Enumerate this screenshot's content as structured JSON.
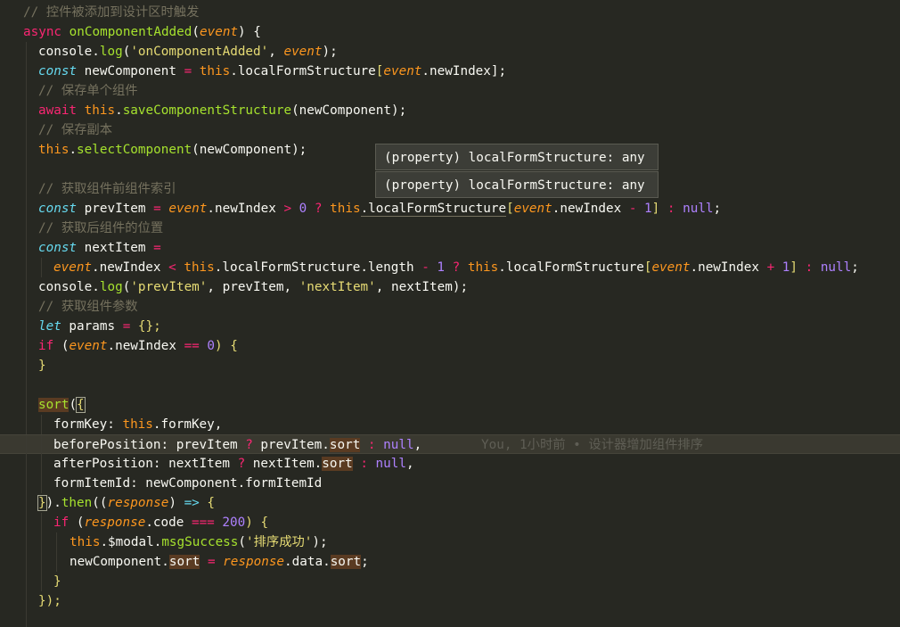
{
  "tooltips": [
    "(property) localFormStructure: any",
    "(property) localFormStructure: any"
  ],
  "blame": "You, 1小时前 • 设计器增加组件排序",
  "lines": {
    "l1": {
      "cm": "// 控件被添加到设计区时触发"
    },
    "l2": {
      "a": "async",
      "b": "onComponentAdded",
      "c": "(",
      "d": "event",
      "e": ") {"
    },
    "l3": {
      "a": "console.",
      "b": "log",
      "c": "(",
      "d": "'onComponentAdded'",
      "e": ", ",
      "f": "event",
      "g": ");"
    },
    "l4": {
      "a": "const",
      "b": " newComponent ",
      "c": "=",
      "d": " this",
      "e": ".localFormStructure",
      "f": "[",
      "g": "event",
      "h": ".newIndex",
      "i": "];"
    },
    "l5": {
      "cm": "// 保存单个组件"
    },
    "l6": {
      "a": "await",
      "b": " this",
      "c": ".",
      "d": "saveComponentStructure",
      "e": "(newComponent);"
    },
    "l7": {
      "cm": "// 保存副本"
    },
    "l8": {
      "a": "this",
      "b": ".",
      "c": "selectComponent",
      "d": "(newComponent);"
    },
    "l10": {
      "cm": "// 获取组件前组件索引"
    },
    "l11": {
      "a": "const",
      "b": " prevItem ",
      "c": "=",
      "d": " event",
      "e": ".newIndex ",
      "f": ">",
      "g": " 0",
      "h": " ? ",
      "i": "this",
      "j": ".localFormStructure",
      "k": "[",
      "l": "event",
      "m": ".newIndex ",
      "n": "-",
      "o": " 1",
      "p": "]",
      "q": " : ",
      "r": "null",
      "s": ";"
    },
    "l12": {
      "cm": "// 获取后组件的位置"
    },
    "l13": {
      "a": "const",
      "b": " nextItem ",
      "c": "="
    },
    "l14": {
      "a": "event",
      "b": ".newIndex ",
      "c": "<",
      "d": " this",
      "e": ".localFormStructure.length ",
      "f": "-",
      "g": " 1",
      "h": " ? ",
      "i": "this",
      "j": ".localFormStructure",
      "k": "[",
      "l": "event",
      "m": ".newIndex ",
      "n": "+",
      "o": " 1",
      "p": "]",
      "q": " : ",
      "r": "null",
      "s": ";"
    },
    "l15": {
      "a": "console.",
      "b": "log",
      "c": "(",
      "d": "'prevItem'",
      "e": ", prevItem, ",
      "f": "'nextItem'",
      "g": ", nextItem);"
    },
    "l16": {
      "cm": "// 获取组件参数"
    },
    "l17": {
      "a": "let",
      "b": " params ",
      "c": "=",
      "d": " {};"
    },
    "l18": {
      "a": "if",
      "b": " (",
      "c": "event",
      "d": ".newIndex ",
      "e": "==",
      "f": " 0",
      "g": ") {"
    },
    "l19": {
      "a": "}"
    },
    "l21": {
      "a": "sort",
      "b": "(",
      "c": "{"
    },
    "l22": {
      "a": "formKey: ",
      "b": "this",
      "c": ".formKey,"
    },
    "l23": {
      "a": "beforePosition: prevItem ",
      "b": "?",
      "c": " prevItem.",
      "d": "sort",
      "e": " : ",
      "f": "null",
      "g": ","
    },
    "l24": {
      "a": "afterPosition: nextItem ",
      "b": "?",
      "c": " nextItem.",
      "d": "sort",
      "e": " : ",
      "f": "null",
      "g": ","
    },
    "l25": {
      "a": "formItemId: newComponent.formItemId"
    },
    "l26": {
      "a": "}",
      "b": ").",
      "c": "then",
      "d": "((",
      "e": "response",
      "f": ") ",
      "g": "=>",
      "h": " {"
    },
    "l27": {
      "a": "if",
      "b": " (",
      "c": "response",
      "d": ".code ",
      "e": "===",
      "f": " 200",
      "g": ") {"
    },
    "l28": {
      "a": "this",
      "b": ".$modal.",
      "c": "msgSuccess",
      "d": "(",
      "e": "'排序成功'",
      "f": ");"
    },
    "l29": {
      "a": "newComponent.",
      "b": "sort",
      "c": " ",
      "d": "=",
      "e": " response",
      "f": ".data.",
      "g": "sort",
      "h": ";"
    },
    "l30": {
      "a": "}"
    },
    "l31": {
      "a": "});"
    }
  }
}
